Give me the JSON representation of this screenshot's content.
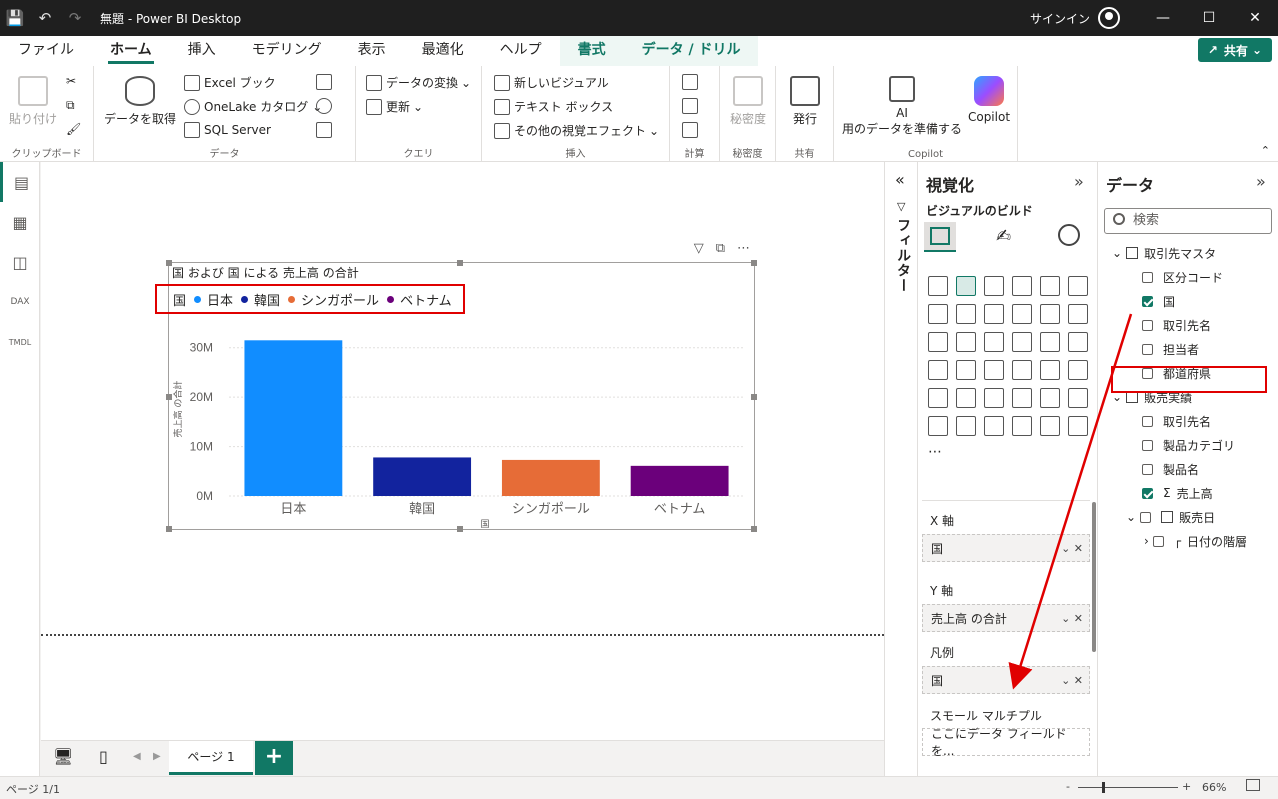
{
  "window": {
    "title": "無題 - Power BI Desktop",
    "signin": "サインイン"
  },
  "tabs": [
    "ファイル",
    "ホーム",
    "挿入",
    "モデリング",
    "表示",
    "最適化",
    "ヘルプ",
    "書式",
    "データ / ドリル"
  ],
  "share_label": "共有",
  "ribbon": {
    "clipboard": {
      "paste": "貼り付け",
      "label": "クリップボード"
    },
    "data": {
      "get_data": "データを取得",
      "excel": "Excel ブック",
      "onelake": "OneLake カタログ",
      "sql": "SQL Server",
      "label": "データ"
    },
    "query": {
      "transform": "データの変換",
      "refresh": "更新",
      "label": "クエリ"
    },
    "insert": {
      "new_visual": "新しいビジュアル",
      "text_box": "テキスト ボックス",
      "more_visuals": "その他の視覚エフェクト",
      "label": "挿入"
    },
    "calc": {
      "label": "計算"
    },
    "sensitivity": {
      "btn": "秘密度",
      "label": "秘密度"
    },
    "share": {
      "publish": "発行",
      "label": "共有"
    },
    "copilot": {
      "ai_line1": "AI",
      "ai_line2": "用のデータを準備する",
      "copilot": "Copilot",
      "label": "Copilot"
    }
  },
  "visual": {
    "title": "国 および 国 による 売上高 の合計",
    "legend_title": "国",
    "ylabel": "売上高 の合計",
    "xlabel": "国"
  },
  "chart_data": {
    "type": "bar",
    "title": "国 および 国 による 売上高 の合計",
    "categories": [
      "日本",
      "韓国",
      "シンガポール",
      "ベトナム"
    ],
    "values": [
      31500000,
      7800000,
      7300000,
      6100000
    ],
    "colors": [
      "#118dff",
      "#12239e",
      "#e66c37",
      "#6b007b"
    ],
    "yticks": [
      "0M",
      "10M",
      "20M",
      "30M"
    ],
    "ylim": [
      0,
      35000000
    ],
    "xlabel": "国",
    "ylabel": "売上高 の合計",
    "legend": [
      "日本",
      "韓国",
      "シンガポール",
      "ベトナム"
    ],
    "legend_position": "top-left",
    "grid": true
  },
  "pages": {
    "tab": "ページ 1",
    "add": "+"
  },
  "status": {
    "page": "ページ 1/1",
    "zoom": "66%",
    "minus": "-",
    "plus": "+"
  },
  "filter_pane": {
    "label": "フィルター"
  },
  "viz_pane": {
    "title": "視覚化",
    "build": "ビジュアルのビルド",
    "wells": {
      "x_label": "X 軸",
      "x_value": "国",
      "y_label": "Y 軸",
      "y_value": "売上高 の合計",
      "legend_label": "凡例",
      "legend_value": "国",
      "small_multiples_label": "スモール マルチプル",
      "small_multiples_placeholder": "ここにデータ フィールドを..."
    }
  },
  "data_pane": {
    "title": "データ",
    "search_placeholder": "検索",
    "tables": [
      {
        "name": "取引先マスタ",
        "fields": [
          {
            "name": "区分コード",
            "checked": false
          },
          {
            "name": "国",
            "checked": true
          },
          {
            "name": "取引先名",
            "checked": false
          },
          {
            "name": "担当者",
            "checked": false
          },
          {
            "name": "都道府県",
            "checked": false
          }
        ]
      },
      {
        "name": "販売実績",
        "fields": [
          {
            "name": "取引先名",
            "checked": false
          },
          {
            "name": "製品カテゴリ",
            "checked": false
          },
          {
            "name": "製品名",
            "checked": false
          },
          {
            "name": "売上高",
            "checked": true
          },
          {
            "name": "販売日",
            "checked": false
          },
          {
            "name": "日付の階層",
            "checked": false
          }
        ]
      }
    ]
  },
  "colors": {
    "accent": "#117865",
    "highlight": "#e00000"
  }
}
